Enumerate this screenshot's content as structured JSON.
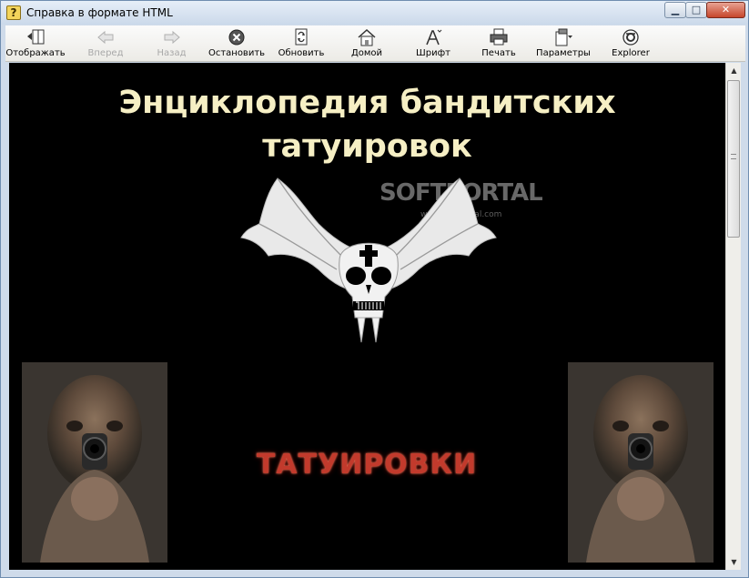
{
  "window": {
    "title": "Справка в формате HTML"
  },
  "toolbar": {
    "buttons": [
      {
        "label": "Отображать",
        "icon": "show-pane-icon",
        "enabled": true
      },
      {
        "label": "Вперед",
        "icon": "arrow-left-icon",
        "enabled": false
      },
      {
        "label": "Назад",
        "icon": "arrow-right-icon",
        "enabled": false
      },
      {
        "label": "Остановить",
        "icon": "stop-icon",
        "enabled": true
      },
      {
        "label": "Обновить",
        "icon": "refresh-icon",
        "enabled": true
      },
      {
        "label": "Домой",
        "icon": "home-icon",
        "enabled": true
      },
      {
        "label": "Шрифт",
        "icon": "font-icon",
        "enabled": true
      },
      {
        "label": "Печать",
        "icon": "printer-icon",
        "enabled": true
      },
      {
        "label": "Параметры",
        "icon": "options-icon",
        "enabled": true
      },
      {
        "label": "Explorer",
        "icon": "explorer-icon",
        "enabled": true
      }
    ]
  },
  "content": {
    "heading_line1": "Энциклопедия бандитских",
    "heading_line2": "татуировок",
    "watermark": "SOFTPORTAL",
    "watermark_sub": "www.softportal.com",
    "link_label": "ТАТУИРОВКИ"
  },
  "colors": {
    "page_background": "#000000",
    "heading": "#f6efc4",
    "link": "#c23a2c"
  }
}
